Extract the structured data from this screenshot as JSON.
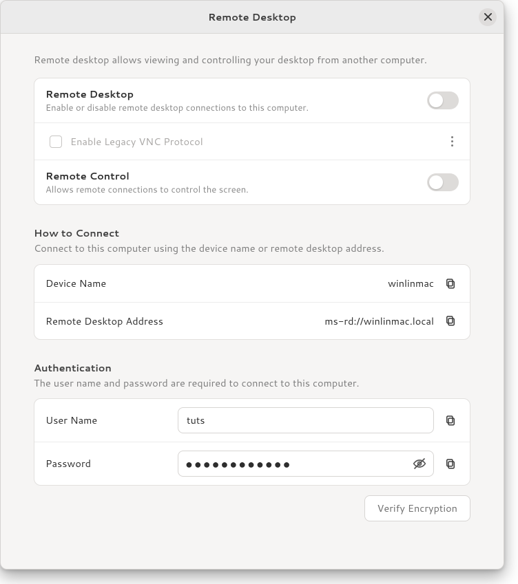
{
  "window": {
    "title": "Remote Desktop"
  },
  "intro": "Remote desktop allows viewing and controlling your desktop from another computer.",
  "toggles": {
    "remote_desktop": {
      "title": "Remote Desktop",
      "subtitle": "Enable or disable remote desktop connections to this computer.",
      "enabled": false
    },
    "vnc": {
      "label": "Enable Legacy VNC Protocol",
      "checked": false
    },
    "remote_control": {
      "title": "Remote Control",
      "subtitle": "Allows remote connections to control the screen.",
      "enabled": false
    }
  },
  "connect": {
    "title": "How to Connect",
    "subtitle": "Connect to this computer using the device name or remote desktop address.",
    "device_name_label": "Device Name",
    "device_name_value": "winlinmac",
    "address_label": "Remote Desktop Address",
    "address_value": "ms-rd://winlinmac.local"
  },
  "auth": {
    "title": "Authentication",
    "subtitle": "The user name and password are required to connect to this computer.",
    "username_label": "User Name",
    "username_value": "tuts",
    "password_label": "Password",
    "password_masked": "●●●●●●●●●●●●"
  },
  "buttons": {
    "verify": "Verify Encryption"
  }
}
